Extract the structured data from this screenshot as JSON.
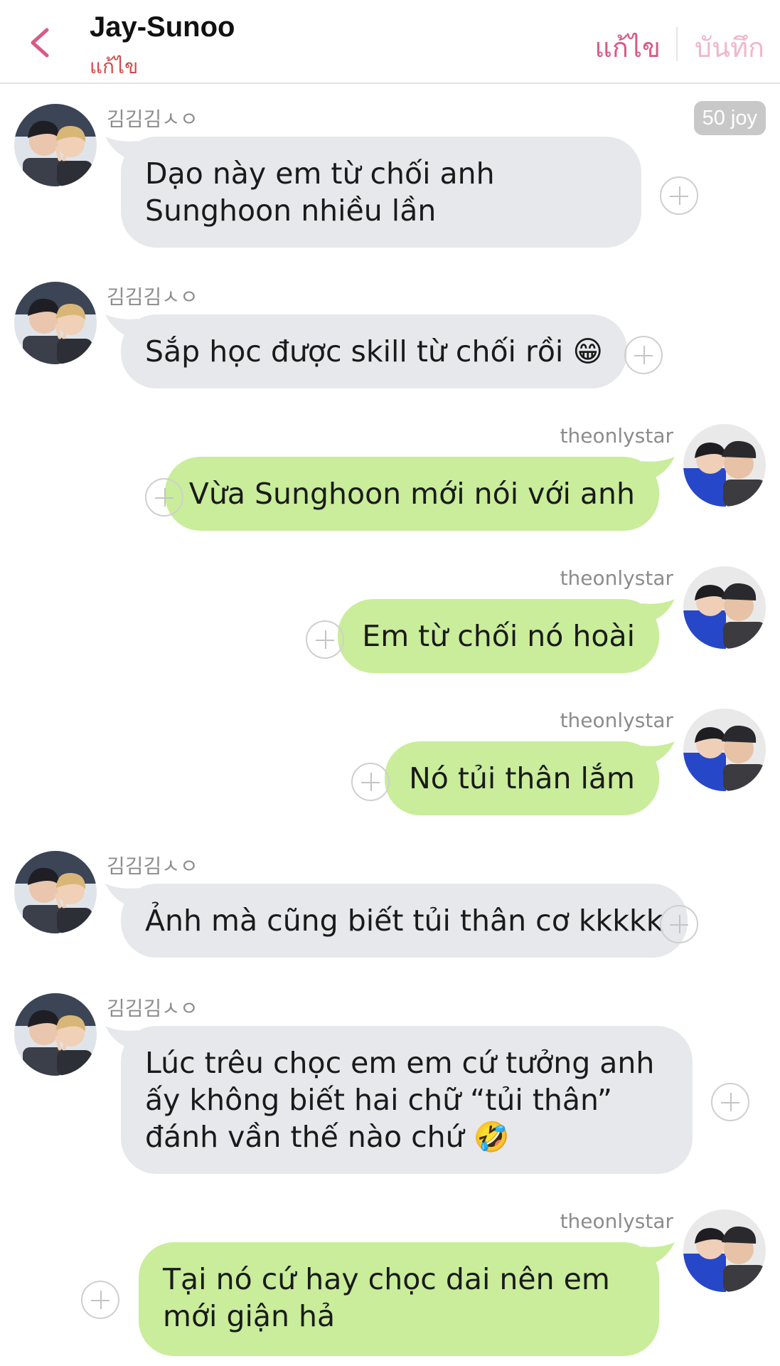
{
  "header": {
    "title": "Jay-Sunoo",
    "subtitle": "แก้ไข",
    "edit_label": "แก้ไข",
    "save_label": "บันทึก",
    "accent": "#d95a86"
  },
  "joy_badge": "50 joy",
  "colors": {
    "incoming_bubble": "#e6e8eb",
    "outgoing_bubble": "#c9ed9a"
  },
  "messages": [
    {
      "sender": "김김김ㅅㅇ",
      "text": "Dạo này em từ chối anh Sunghoon nhiều lần",
      "side": "left"
    },
    {
      "sender": "김김김ㅅㅇ",
      "text": "Sắp học được skill từ chối rồi 😁",
      "side": "left"
    },
    {
      "sender": "theonlystar",
      "text": "Vừa Sunghoon mới nói với anh",
      "side": "right"
    },
    {
      "sender": "theonlystar",
      "text": "Em từ chối nó hoài",
      "side": "right"
    },
    {
      "sender": "theonlystar",
      "text": "Nó tủi thân lắm",
      "side": "right"
    },
    {
      "sender": "김김김ㅅㅇ",
      "text": "Ảnh mà cũng biết tủi thân cơ kkkkk",
      "side": "left"
    },
    {
      "sender": "김김김ㅅㅇ",
      "text": "Lúc trêu chọc em em cứ tưởng anh ấy không biết hai chữ “tủi thân” đánh vần thế nào chứ 🤣",
      "side": "left"
    },
    {
      "sender": "theonlystar",
      "text": "Tại nó cứ hay chọc dai nên em mới giận hả",
      "side": "right"
    }
  ]
}
